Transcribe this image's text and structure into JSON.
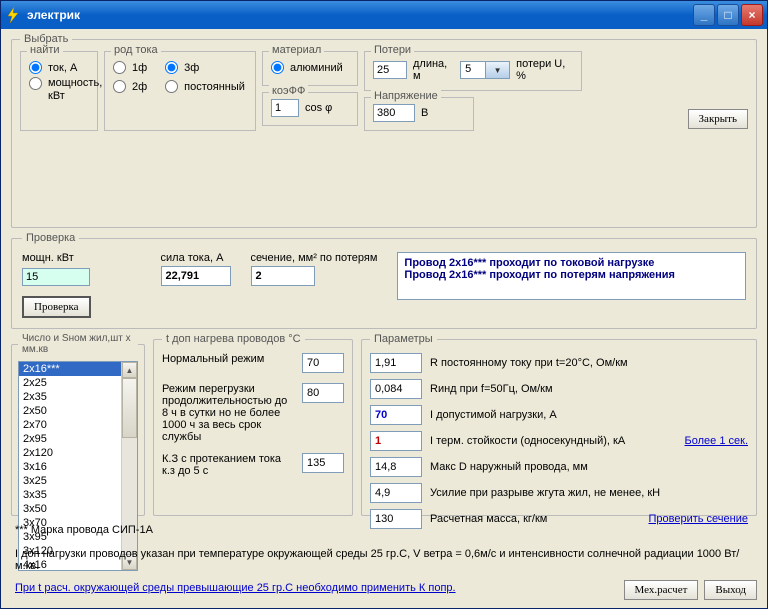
{
  "window": {
    "title": "электрик"
  },
  "chooseLegend": "Выбрать",
  "find": {
    "legend": "найти",
    "current": "ток, А",
    "power": "мощность, кВт"
  },
  "currentType": {
    "legend": "род тока",
    "p1": "1ф",
    "p2": "2ф",
    "p3": "3ф",
    "dc": "постоянный"
  },
  "material": {
    "legend": "материал",
    "aluminum": "алюминий"
  },
  "losses": {
    "legend": "Потери",
    "length": "25",
    "lengthLabel": "длина, м",
    "percent": "5",
    "percentLabel": "потери U, %"
  },
  "koeffLegend": "коэФФ",
  "koeffVal": "1",
  "koeffLabel": "cos φ",
  "voltageLegend": "Напряжение",
  "voltageVal": "380",
  "voltageUnit": "В",
  "closeBtn": "Закрыть",
  "check": {
    "legend": "Проверка",
    "powerLabel": "мощн. кВт",
    "powerVal": "15",
    "currentLabel": "сила тока, А",
    "currentVal": "22,791",
    "sectionLabel": "сечение, мм² по потерям",
    "sectionVal": "2",
    "btn": "Проверка",
    "result1": "Провод 2х16*** проходит по токовой нагрузке",
    "result2": "Провод 2х16*** проходит по потерям напряжения"
  },
  "wireList": {
    "legend": "Число и Sном жил,шт x мм.кв",
    "items": [
      "2x16***",
      "2x25",
      "2x35",
      "2x50",
      "2x70",
      "2x95",
      "2x120",
      "3x16",
      "3x25",
      "3x35",
      "3x50",
      "3x70",
      "3x95",
      "3x120",
      "4x16"
    ],
    "selectedIndex": 0
  },
  "heat": {
    "legend": "t доп нагрева проводов °C",
    "r1label": "Нормальный режим",
    "r1val": "70",
    "r2label": "Режим перегрузки продолжительностью до 8 ч в сутки но не более 1000 ч за весь срок службы",
    "r2val": "80",
    "r3label": "К.З с протеканием тока к.з до 5 с",
    "r3val": "135"
  },
  "params": {
    "legend": "Параметры",
    "v1": "1,91",
    "l1": "R постоянному току при t=20°C, Ом/км",
    "v2": "0,084",
    "l2": "Rинд при f=50Гц, Ом/км",
    "v3": "70",
    "l3": "I допустимой нагрузки, A",
    "v4": "1",
    "l4": "I терм. стойкости (односекундный), кА",
    "link4": "Более 1 сек.",
    "v5": "14,8",
    "l5": "Макс D наружный провода, мм",
    "v6": "4,9",
    "l6": "Усилие при разрыве жгута жил, не менее, кН",
    "v7": "130",
    "l7": "Расчетная масса, кг/км",
    "link7": "Проверить сечение"
  },
  "note1": "*** Марка провода СИП-1А",
  "note2": "I доп нагрузки проводов указан при температуре окружающей среды 25 гр.С, V ветра = 0,6м/с  и интенсивности солнечной радиации 1000 Вт/м.кв.",
  "note3": "При t расч. окружающей среды превышающие 25 гр.С необходимо применить К попр.",
  "mechBtn": "Мех.расчет",
  "exitBtn": "Выход"
}
